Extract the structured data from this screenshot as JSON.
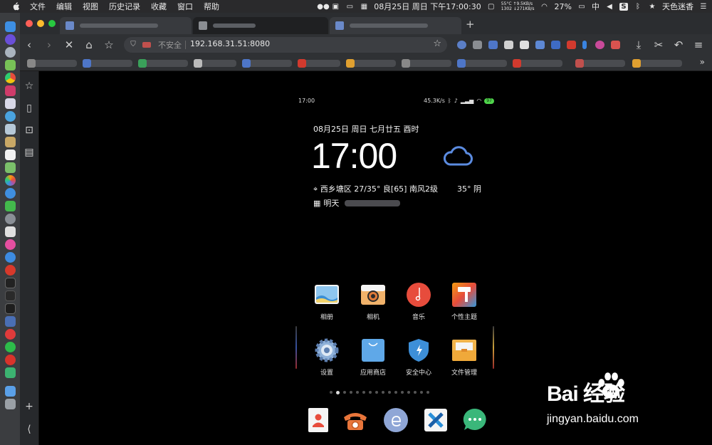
{
  "menubar": {
    "items": [
      "文件",
      "编辑",
      "视图",
      "历史记录",
      "收藏",
      "窗口",
      "帮助"
    ],
    "sensor_top": "55°C ↑9.5KB/s",
    "sensor_bottom": "1302 ↓271KB/s",
    "datetime": "08月25日 周日 下午17:00:30",
    "battery": "27%",
    "input_method": "中",
    "user": "天色迷香"
  },
  "browser": {
    "new_tab": "+",
    "secure_label": "不安全",
    "url": "192.168.31.51:8080",
    "bookmarks_more": "»"
  },
  "phone": {
    "status_time": "17:00",
    "net_speed": "45.3K/s",
    "battery": "97",
    "date_line": "08月25日  周日  七月廿五  酉时",
    "clock": "17:00",
    "location_line": "西乡塘区  27/35°  良[65]  南风2级",
    "temp_now": "35°  阴",
    "tomorrow_label": "明天",
    "apps_row1": [
      {
        "label": "相册",
        "icon": "gallery-icon"
      },
      {
        "label": "相机",
        "icon": "camera-icon"
      },
      {
        "label": "音乐",
        "icon": "music-icon"
      },
      {
        "label": "个性主题",
        "icon": "theme-icon"
      }
    ],
    "apps_row2": [
      {
        "label": "设置",
        "icon": "settings-icon"
      },
      {
        "label": "应用商店",
        "icon": "app-store-icon"
      },
      {
        "label": "安全中心",
        "icon": "security-icon"
      },
      {
        "label": "文件管理",
        "icon": "file-manager-icon"
      }
    ],
    "dock": [
      "contacts-icon",
      "phone-icon",
      "browser-icon",
      "xiaomi-service-icon",
      "messages-icon"
    ],
    "page_count": 16,
    "active_page": 2
  },
  "watermark": {
    "brand": "Bai  经验",
    "domain": "jingyan.baidu.com"
  },
  "colors": {
    "accent_blue": "#5b8be0",
    "music_red": "#e74c3c",
    "battery_green": "#4fd34b"
  }
}
